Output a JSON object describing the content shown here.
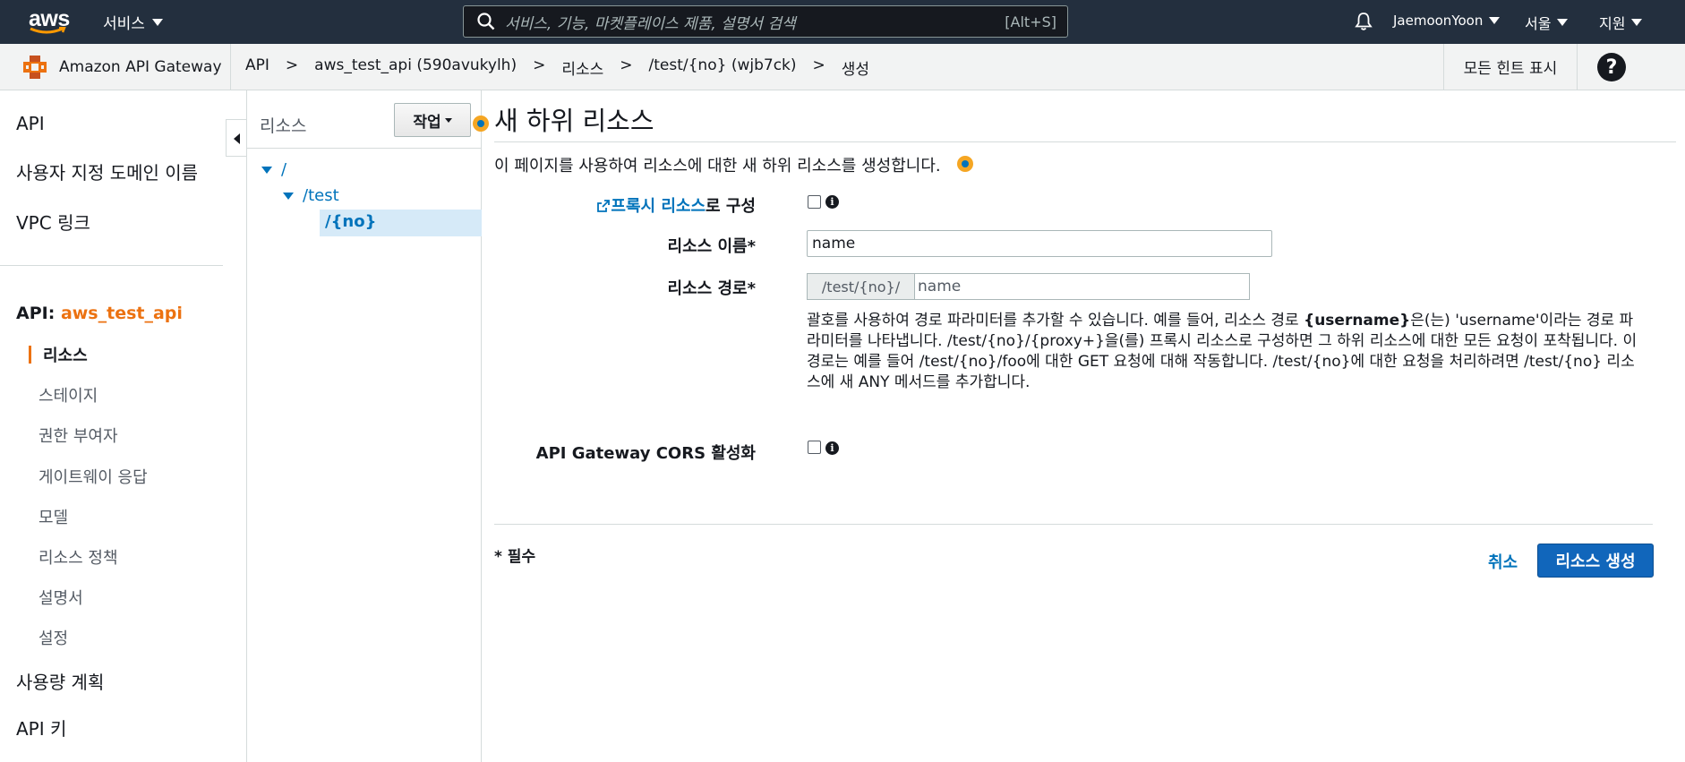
{
  "topnav": {
    "logo_text": "aws",
    "services_label": "서비스",
    "search_placeholder": "서비스, 기능, 마켓플레이스 제품, 설명서 검색",
    "search_shortcut": "[Alt+S]",
    "user": "JaemoonYoon",
    "region": "서울",
    "support": "지원"
  },
  "breadcrumb": {
    "service_name": "Amazon API Gateway",
    "items": [
      "API",
      "aws_test_api (590avukylh)",
      "리소스",
      "/test/{no} (wjb7ck)",
      "생성"
    ],
    "separator": ">",
    "hint_button": "모든 힌트 표시",
    "help_icon_text": "?"
  },
  "leftnav": {
    "top_items": [
      "API",
      "사용자 지정 도메인 이름",
      "VPC 링크"
    ],
    "api_prefix": "API:",
    "api_name": "aws_test_api",
    "active_item": "리소스",
    "sub_items": [
      "스테이지",
      "권한 부여자",
      "게이트웨이 응답",
      "모델",
      "리소스 정책",
      "설명서",
      "설정"
    ],
    "bottom_items": [
      "사용량 계획",
      "API 키"
    ]
  },
  "tree": {
    "title": "리소스",
    "action_button": "작업",
    "nodes": [
      "/",
      "/test",
      "/{no}"
    ]
  },
  "main": {
    "title": "새 하위 리소스",
    "description": "이 페이지를 사용하여 리소스에 대한 새 하위 리소스를 생성합니다.",
    "proxy_link": "프록시 리소스",
    "proxy_suffix": "로 구성",
    "name_label": "리소스 이름*",
    "name_value": "name",
    "path_label": "리소스 경로*",
    "path_prefix": "/test/{no}/",
    "path_value": "name",
    "help_line1a": "괄호를 사용하여 경로 파라미터를 추가할 수 있습니다. 예를 들어, 리소스 경로 ",
    "help_bold": "{username}",
    "help_line1b": "은(는) 'username'이라는 경로 파라미터를 나타냅니다. /test/{no}/{proxy+}을(를) 프록시 리소스로 구성하면 그 하위 리소스에 대한 모든 요청이 포착됩니다. 이 경로는 예를 들어 /test/{no}/foo에 대한 GET 요청에 대해 작동합니다. /test/{no}에 대한 요청을 처리하려면 /test/{no} 리소스에 새 ANY 메서드를 추가합니다.",
    "cors_label": "API Gateway CORS 활성화",
    "info_glyph": "i",
    "required_note": "* 필수",
    "cancel": "취소",
    "create": "리소스 생성"
  },
  "colors": {
    "nav_bg": "#232f3e",
    "accent_orange": "#ec7211",
    "link_blue": "#0073bb",
    "primary_button": "#1166bb"
  }
}
